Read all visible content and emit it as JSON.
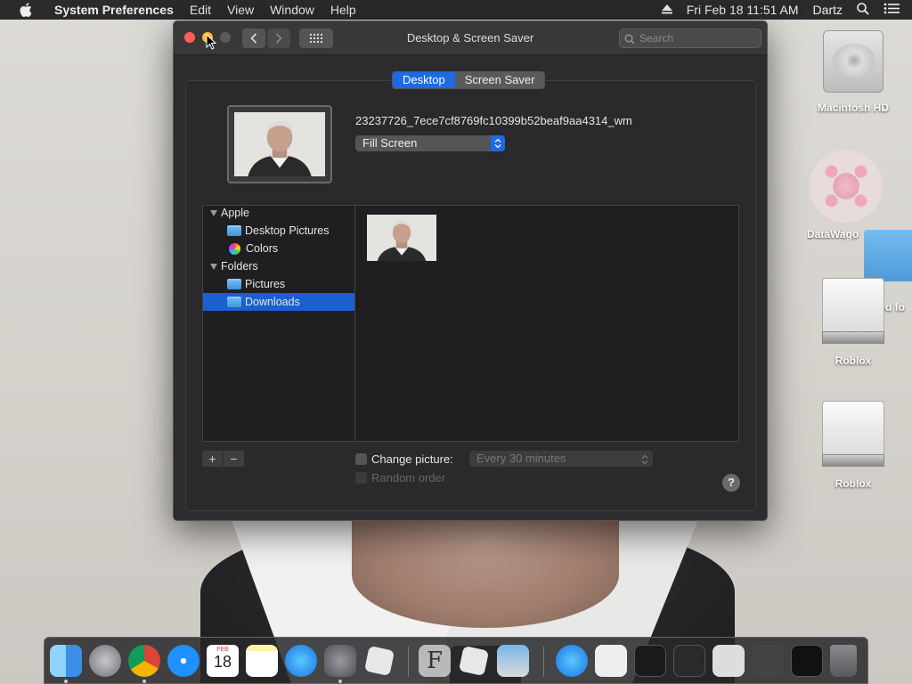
{
  "menubar": {
    "app_name": "System Preferences",
    "menus": [
      "Edit",
      "View",
      "Window",
      "Help"
    ],
    "datetime": "Fri Feb 18  11:51 AM",
    "user": "Dartz"
  },
  "window": {
    "title": "Desktop & Screen Saver",
    "search_placeholder": "Search",
    "tabs": [
      {
        "label": "Desktop",
        "active": true
      },
      {
        "label": "Screen Saver",
        "active": false
      }
    ],
    "current_image_name": "23237726_7ece7cf8769fc10399b52beaf9aa4314_wm",
    "fit_option": "Fill Screen",
    "sidebar": {
      "groups": [
        {
          "label": "Apple",
          "items": [
            {
              "label": "Desktop Pictures",
              "icon": "folder-icon"
            },
            {
              "label": "Colors",
              "icon": "color-wheel-icon"
            }
          ]
        },
        {
          "label": "Folders",
          "items": [
            {
              "label": "Pictures",
              "icon": "folder-icon"
            },
            {
              "label": "Downloads",
              "icon": "folder-icon",
              "selected": true
            }
          ]
        }
      ]
    },
    "add_label": "+",
    "remove_label": "−",
    "change_picture_label": "Change picture:",
    "interval_value": "Every 30 minutes",
    "random_order_label": "Random order",
    "help_label": "?"
  },
  "desktop": {
    "icons": [
      {
        "label": "Macintosh HD"
      },
      {
        "label": "DataWago"
      },
      {
        "label": "led fo"
      },
      {
        "label": "Roblox"
      },
      {
        "label": "Roblox"
      }
    ]
  },
  "dock": {
    "calendar_month": "FEB",
    "calendar_day": "18",
    "font_app_letter": "F"
  },
  "colors": {
    "accent": "#1b6ae6",
    "selection": "#1b5fd1",
    "close": "#ff5f57",
    "minimize": "#febc2e"
  }
}
